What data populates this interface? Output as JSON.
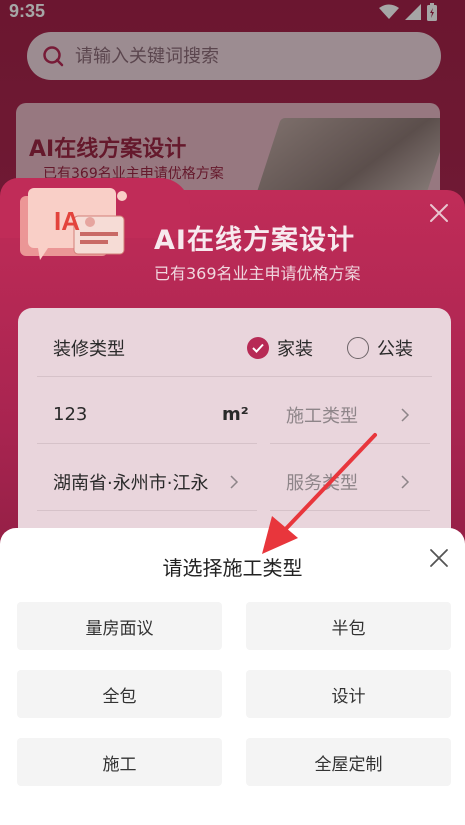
{
  "status_bar": {
    "time": "9:35",
    "icons": [
      "wifi-icon",
      "signal-icon",
      "battery-charging-icon"
    ]
  },
  "search": {
    "placeholder": "请输入关键词搜索"
  },
  "banner": {
    "title": "AI在线方案设计",
    "subtitle": "已有369名业主申请优格方案"
  },
  "modal": {
    "icon_text": "IA",
    "title": "AI在线方案设计",
    "subtitle": "已有369名业主申请优格方案",
    "form": {
      "decoration_type_label": "装修类型",
      "options": [
        {
          "label": "家装",
          "selected": true
        },
        {
          "label": "公装",
          "selected": false
        }
      ],
      "area_value": "123",
      "area_unit": "m²",
      "construction_type_placeholder": "施工类型",
      "location_value": "湖南省·永州市·江永",
      "service_type_placeholder": "服务类型"
    }
  },
  "sheet": {
    "title": "请选择施工类型",
    "options": [
      "量房面议",
      "半包",
      "全包",
      "设计",
      "施工",
      "全屋定制"
    ]
  },
  "colors": {
    "accent": "#b72a55",
    "annotation_arrow": "#e8363c"
  }
}
